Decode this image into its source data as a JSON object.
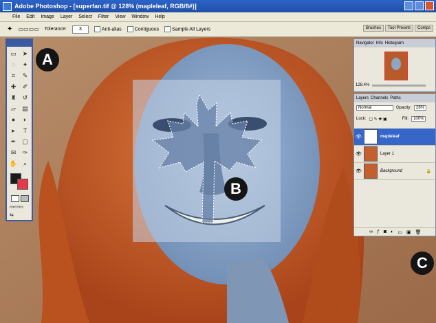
{
  "title_bar": {
    "text": "Adobe Photoshop - [superfan.tif @ 128% (mapleleaf, RGB/8#)]"
  },
  "menu": [
    "File",
    "Edit",
    "Image",
    "Layer",
    "Select",
    "Filter",
    "View",
    "Window",
    "Help"
  ],
  "options_bar": {
    "tolerance_label": "Tolerance:",
    "tolerance_value": "3",
    "anti_alias": "Anti-alias",
    "contiguous": "Contiguous",
    "sample_all": "Sample All Layers",
    "panel_tabs": [
      "Brushes",
      "Tool Presets",
      "Comps"
    ]
  },
  "navigator": {
    "tabs": [
      "Navigator",
      "Info",
      "Histogram"
    ],
    "zoom": "128.4%"
  },
  "layers_panel": {
    "tabs": [
      "Layers",
      "Channels",
      "Paths"
    ],
    "blend_mode": "Normal",
    "opacity_label": "Opacity:",
    "opacity_value": "28%",
    "lock_label": "Lock:",
    "fill_label": "Fill:",
    "fill_value": "100%",
    "layers": [
      {
        "name": "mapleleaf",
        "selected": true
      },
      {
        "name": "Layer 1",
        "selected": false
      },
      {
        "name": "Background",
        "selected": false
      }
    ]
  },
  "callouts": [
    "A",
    "B",
    "C"
  ],
  "colors": {
    "face_blue": "#8fa9c9",
    "hair": "#c25a22",
    "title_blue": "#2d63c7"
  }
}
